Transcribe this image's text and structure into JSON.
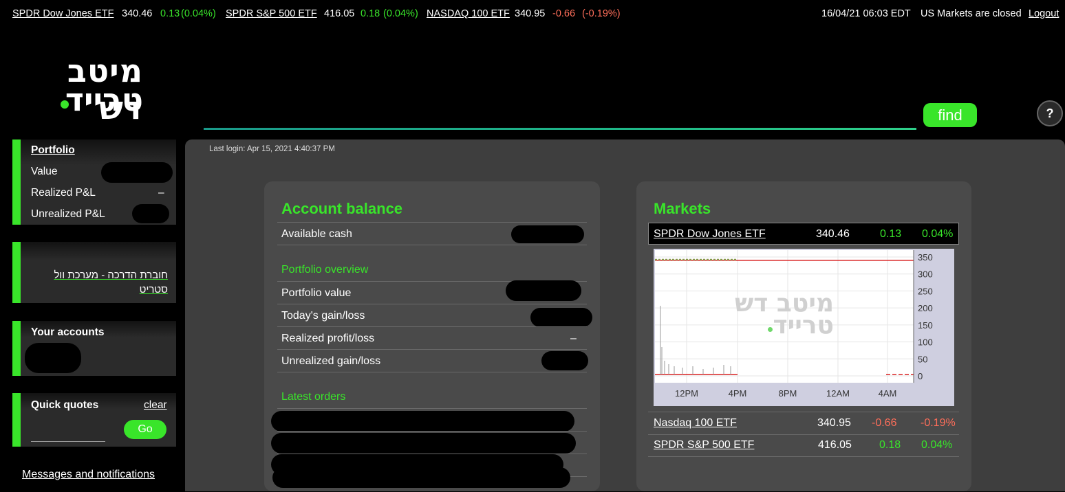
{
  "ticker": {
    "items": [
      {
        "name": "SPDR Dow Jones ETF",
        "price": "340.46",
        "change": "0.13",
        "pct": "(0.04%)"
      },
      {
        "name": "SPDR S&P 500 ETF",
        "price": "416.05",
        "change": "0.18",
        "pct": "(0.04%)"
      },
      {
        "name": "NASDAQ 100 ETF",
        "price": "340.95",
        "change": "-0.66",
        "pct": "(-0.19%)"
      }
    ],
    "datetime": "16/04/21 06:03 EDT",
    "market_status": "US Markets are closed",
    "logout": "Logout"
  },
  "logo": {
    "line1": "מיטב דש",
    "line2": "טרייד"
  },
  "search": {
    "placeholder": "",
    "find_label": "find",
    "help_label": "?"
  },
  "sidebar": {
    "portfolio": {
      "title": "Portfolio",
      "value_label": "Value",
      "realized_label": "Realized P&L",
      "realized_value": "–",
      "unrealized_label": "Unrealized P&L"
    },
    "guide_link_line1": "חוברת הדרכה - מערכת וול",
    "guide_link_line2": "סטריט",
    "accounts_title": "Your accounts",
    "quick_quotes": {
      "title": "Quick quotes",
      "clear": "clear",
      "go": "Go"
    },
    "messages": "Messages and notifications"
  },
  "main": {
    "last_login": "Last login: Apr 15, 2021 4:40:37 PM",
    "account_balance": {
      "title": "Account balance",
      "available_cash": "Available cash",
      "overview_title": "Portfolio overview",
      "portfolio_value": "Portfolio value",
      "todays_gain": "Today's gain/loss",
      "realized": "Realized profit/loss",
      "realized_value": "–",
      "unrealized": "Unrealized gain/loss",
      "latest_orders": "Latest orders"
    },
    "markets": {
      "title": "Markets",
      "rows": [
        {
          "name": "SPDR Dow Jones ETF",
          "price": "340.46",
          "change": "0.13",
          "pct": "0.04%"
        },
        {
          "name": "Nasdaq 100 ETF",
          "price": "340.95",
          "change": "-0.66",
          "pct": "-0.19%"
        },
        {
          "name": "SPDR S&P 500 ETF",
          "price": "416.05",
          "change": "0.18",
          "pct": "0.04%"
        }
      ]
    }
  },
  "colors": {
    "accent": "#39e52a",
    "negative": "#ff6e5a",
    "panel": "#4a4a4a",
    "background": "#000000"
  },
  "chart_data": {
    "type": "line",
    "title": "",
    "x_ticks": [
      "12PM",
      "4PM",
      "8PM",
      "12AM",
      "4AM"
    ],
    "y_ticks": [
      "350",
      "300",
      "250",
      "200",
      "150",
      "100",
      "50",
      "0"
    ],
    "ylim": [
      0,
      360
    ],
    "watermark_line1": "מיטב דש",
    "watermark_line2": "טרייד",
    "price_level": 340.46
  }
}
